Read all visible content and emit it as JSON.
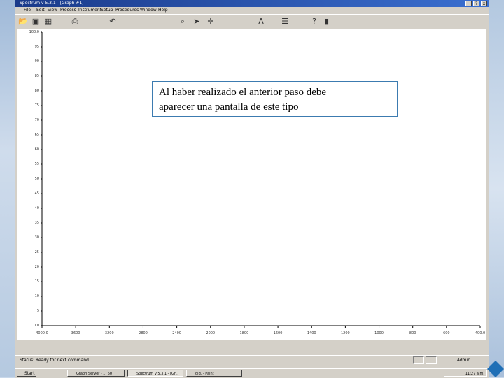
{
  "window": {
    "title": "Spectrum v 5.3.1 - [Graph #1]",
    "buttons": [
      "_",
      "?",
      "x"
    ]
  },
  "menu": [
    "File",
    "Edit",
    "View",
    "Process",
    "Instrument",
    "Setup",
    "Procedures",
    "Window",
    "Help"
  ],
  "toolbar": {
    "icons": [
      "open-icon",
      "save-icon",
      "graph-icon",
      "print-icon",
      "undo-icon",
      "zoom-icon",
      "arrow-icon",
      "move-icon",
      "text-icon",
      "grid-icon",
      "help-icon",
      "scan-icon"
    ]
  },
  "chart_data": {
    "type": "line",
    "title": "",
    "xlabel": "",
    "ylabel": "",
    "xlim": [
      4000,
      400
    ],
    "ylim": [
      0,
      100
    ],
    "x_tick_labels": [
      "4000.0",
      "3600",
      "3200",
      "2800",
      "2400",
      "2000",
      "1800",
      "1600",
      "1400",
      "1200",
      "1000",
      "800",
      "600",
      "400.0"
    ],
    "y_tick_labels": [
      "100.0",
      "95",
      "90",
      "85",
      "80",
      "75",
      "70",
      "65",
      "60",
      "55",
      "50",
      "45",
      "40",
      "35",
      "30",
      "25",
      "20",
      "15",
      "10",
      "5",
      "0.0"
    ],
    "series": []
  },
  "callout": {
    "line1": "Al haber  realizado el anterior paso debe",
    "line2": "aparecer una pantalla de este tipo"
  },
  "status": {
    "text": "Status: Ready for next command...",
    "user": "Admin"
  },
  "taskbar": {
    "start": "Start",
    "tasks": [
      "Graph Server - ... 60",
      "Spectrum v 5.3.1 - [Gr...",
      "dig. - Paint"
    ],
    "clock": "11:27 a.m."
  }
}
